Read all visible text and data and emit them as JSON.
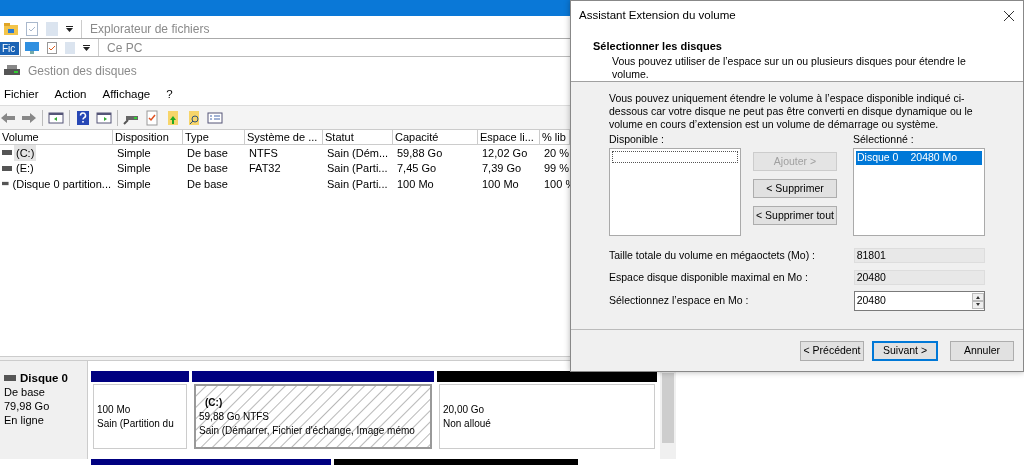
{
  "explorer_windows": [
    {
      "title": "Explorateur de fichiers",
      "ribbon_tab": "Fic"
    },
    {
      "title": "Ce PC"
    }
  ],
  "disk_management": {
    "title": "Gestion des disques",
    "menu": [
      "Fichier",
      "Action",
      "Affichage",
      "?"
    ],
    "table": {
      "columns": [
        "Volume",
        "Disposition",
        "Type",
        "Système de ...",
        "Statut",
        "Capacité",
        "Espace li...",
        "% lib"
      ],
      "rows": [
        {
          "selected": true,
          "cells": [
            "(C:)",
            "Simple",
            "De base",
            "NTFS",
            "Sain (Dém...",
            "59,88 Go",
            "12,02 Go",
            "20 %"
          ]
        },
        {
          "selected": false,
          "cells": [
            "(E:)",
            "Simple",
            "De base",
            "FAT32",
            "Sain (Parti...",
            "7,45 Go",
            "7,39 Go",
            "99 %"
          ]
        },
        {
          "selected": false,
          "cells": [
            "(Disque 0 partition...",
            "Simple",
            "De base",
            "",
            "Sain (Parti...",
            "100 Mo",
            "100 Mo",
            "100 %"
          ]
        }
      ]
    },
    "disks": [
      {
        "name": "Disque 0",
        "type": "De base",
        "size": "79,98 Go",
        "status": "En ligne",
        "partitions": [
          {
            "kind": "primary",
            "selected": false,
            "size": "100 Mo",
            "status": "Sain (Partition du"
          },
          {
            "kind": "primary",
            "selected": true,
            "label": "(C:)",
            "size": "59,88 Go NTFS",
            "status": "Sain (Démarrer, Fichier d'échange, Image mémo"
          },
          {
            "kind": "unallocated",
            "selected": false,
            "size": "20,00 Go",
            "status": "Non alloué"
          }
        ]
      }
    ]
  },
  "dialog": {
    "title": "Assistant Extension du volume",
    "heading": "Sélectionner les disques",
    "description": "Vous pouvez utiliser de l’espace sur un ou plusieurs disques pour étendre le volume.",
    "intro": "Vous pouvez uniquement étendre le volume à l’espace disponible indiqué ci-dessous car votre disque ne peut pas être converti en disque dynamique ou le volume en cours d’extension est un volume de démarrage ou système.",
    "available": {
      "label": "Disponible :"
    },
    "move_buttons": [
      {
        "label": "Ajouter >",
        "disabled": true
      },
      {
        "label": "< Supprimer",
        "disabled": false
      },
      {
        "label": "< Supprimer tout",
        "disabled": false
      }
    ],
    "selected_list": {
      "label": "Sélectionné :",
      "items": [
        {
          "disk": "Disque 0",
          "size": "20480 Mo",
          "selected": true
        }
      ]
    },
    "fields": [
      {
        "kind": "readonly",
        "label": "Taille totale du volume en mégaoctets (Mo) :",
        "value": "81801"
      },
      {
        "kind": "readonly",
        "label": "Espace disque disponible maximal en Mo :",
        "value": "20480"
      },
      {
        "kind": "spin",
        "label": "Sélectionnez l’espace en Mo :",
        "value": "20480"
      }
    ],
    "buttons": [
      {
        "label": "< Précédent",
        "default": false
      },
      {
        "label": "Suivant >",
        "default": true
      },
      {
        "label": "Annuler",
        "default": false
      }
    ]
  }
}
